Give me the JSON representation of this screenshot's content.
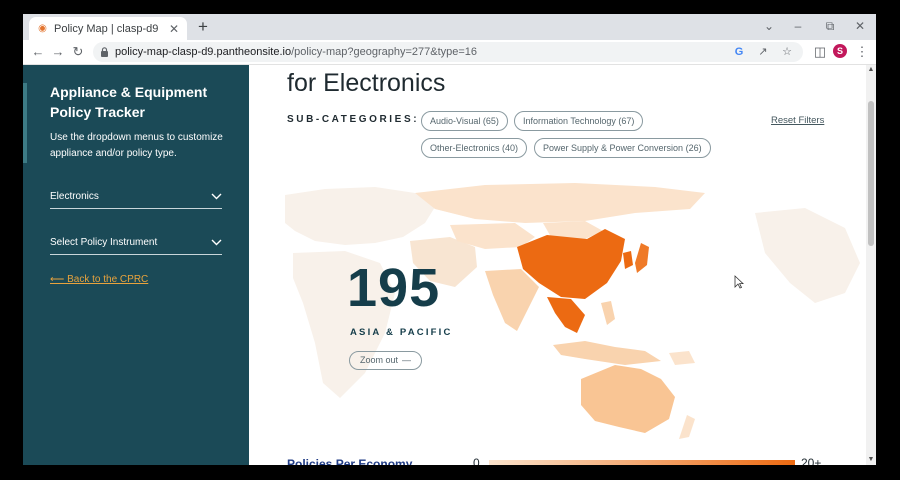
{
  "browser": {
    "tab_title": "Policy Map | clasp-d9",
    "url_host": "policy-map-clasp-d9.pantheonsite.io",
    "url_path": "/policy-map?geography=277&type=16",
    "avatar_letter": "S"
  },
  "sidebar": {
    "title": "Appliance & Equipment Policy Tracker",
    "description": "Use the dropdown menus to customize appliance and/or policy type.",
    "appliance_select": "Electronics",
    "policy_select": "Select Policy Instrument",
    "back_link": "⟵ Back to the CPRC"
  },
  "main": {
    "heading": "for Electronics",
    "subcategories_label": "SUB-CATEGORIES:",
    "chips": [
      {
        "label": "Audio-Visual (65)"
      },
      {
        "label": "Information Technology (67)"
      },
      {
        "label": "Other-Electronics (40)"
      },
      {
        "label": "Power Supply & Power Conversion (26)"
      }
    ],
    "reset_label": "Reset Filters"
  },
  "map": {
    "count": "195",
    "region": "ASIA & PACIFIC",
    "zoom_label": "Zoom out",
    "colors": {
      "high": "#ec6a12",
      "mid": "#f7c9a0",
      "low": "#fbe3cc",
      "none": "#f7efe6"
    }
  },
  "legend": {
    "title": "Policies Per Economy",
    "min": "0",
    "max": "20+"
  }
}
